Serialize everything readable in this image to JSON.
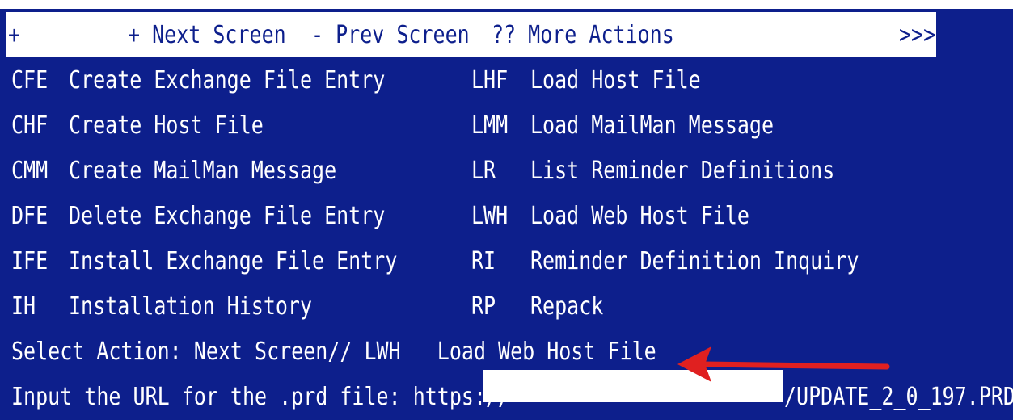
{
  "menu": {
    "plus": "+",
    "next_screen": "+ Next Screen",
    "prev_screen": "- Prev Screen",
    "more_actions": "?? More Actions",
    "more_indicator": ">>>"
  },
  "actions_left": [
    {
      "code": "CFE",
      "label": "Create Exchange File Entry"
    },
    {
      "code": "CHF",
      "label": "Create Host File"
    },
    {
      "code": "CMM",
      "label": "Create MailMan Message"
    },
    {
      "code": "DFE",
      "label": "Delete Exchange File Entry"
    },
    {
      "code": "IFE",
      "label": "Install Exchange File Entry"
    },
    {
      "code": "IH",
      "label": "Installation History"
    }
  ],
  "actions_right": [
    {
      "code": "LHF",
      "label": "Load Host File"
    },
    {
      "code": "LMM",
      "label": "Load MailMan Message"
    },
    {
      "code": "LR",
      "label": "List Reminder Definitions"
    },
    {
      "code": "LWH",
      "label": "Load Web Host File"
    },
    {
      "code": "RI",
      "label": "Reminder Definition Inquiry"
    },
    {
      "code": "RP",
      "label": "Repack"
    }
  ],
  "prompt": {
    "select_action": "Select Action: Next Screen// LWH   Load Web Host File",
    "url_prompt": "Input the URL for the .prd file: https://",
    "url_suffix": "/UPDATE_2_0_197.PRD"
  },
  "colors": {
    "terminal_bg": "#0d1f8c",
    "text": "#ffffff",
    "arrow": "#e02020"
  }
}
